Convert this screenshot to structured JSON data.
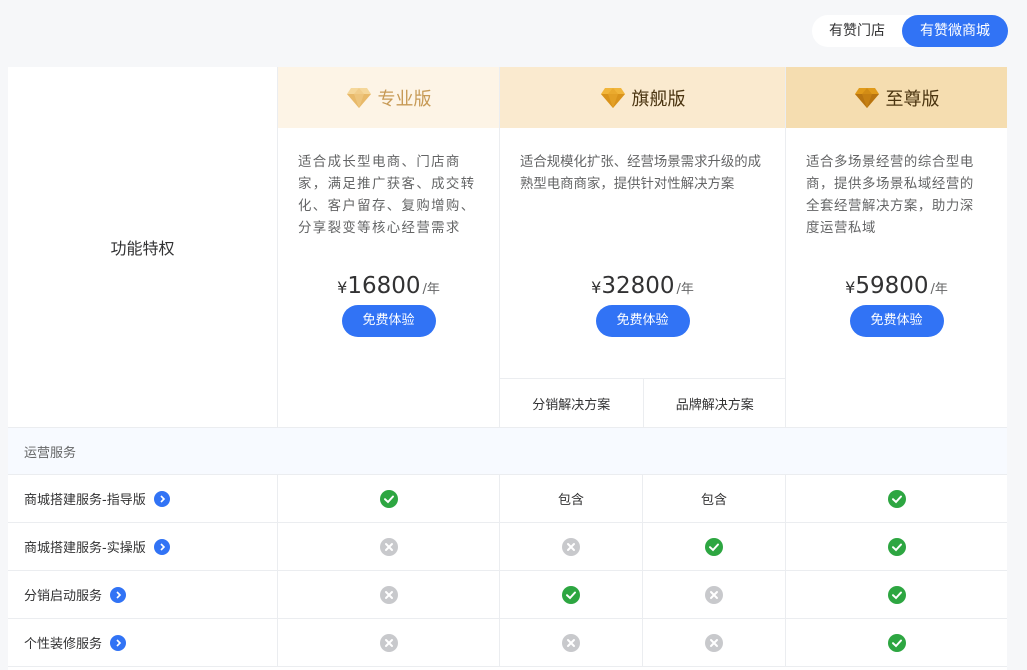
{
  "toggle": {
    "options": [
      "有赞门店",
      "有赞微商城"
    ],
    "selected": "有赞微商城"
  },
  "header": {
    "feature_label": "功能特权",
    "plans": [
      {
        "name": "专业版",
        "icon": "diamond-icon",
        "description": "适合成长型电商、门店商家，满足推广获客、成交转化、客户留存、复购增购、分享裂变等核心经营需求",
        "currency": "¥",
        "price": "16800",
        "unit": "/年",
        "button": "免费体验"
      },
      {
        "name": "旗舰版",
        "icon": "diamond-icon",
        "description": "适合规模化扩张、经营场景需求升级的成熟型电商商家，提供针对性解决方案",
        "currency": "¥",
        "price": "32800",
        "unit": "/年",
        "button": "免费体验",
        "subtabs": [
          "分销解决方案",
          "品牌解决方案"
        ]
      },
      {
        "name": "至尊版",
        "icon": "diamond-icon",
        "description": "适合多场景经营的综合型电商，提供多场景私域经营的全套经营解决方案，助力深度运营私域",
        "currency": "¥",
        "price": "59800",
        "unit": "/年",
        "button": "免费体验"
      }
    ]
  },
  "section": {
    "title": "运营服务"
  },
  "rows": [
    {
      "name": "商城搭建服务-指导版",
      "cells": [
        "check",
        "包含",
        "包含",
        "check"
      ]
    },
    {
      "name": "商城搭建服务-实操版",
      "cells": [
        "cross",
        "cross",
        "check",
        "check"
      ]
    },
    {
      "name": "分销启动服务",
      "cells": [
        "cross",
        "check",
        "cross",
        "check"
      ]
    },
    {
      "name": "个性装修服务",
      "cells": [
        "cross",
        "cross",
        "cross",
        "check"
      ]
    }
  ],
  "colors": {
    "accent": "#3173f5",
    "check": "#2da641",
    "cross": "#c8c9cc"
  }
}
